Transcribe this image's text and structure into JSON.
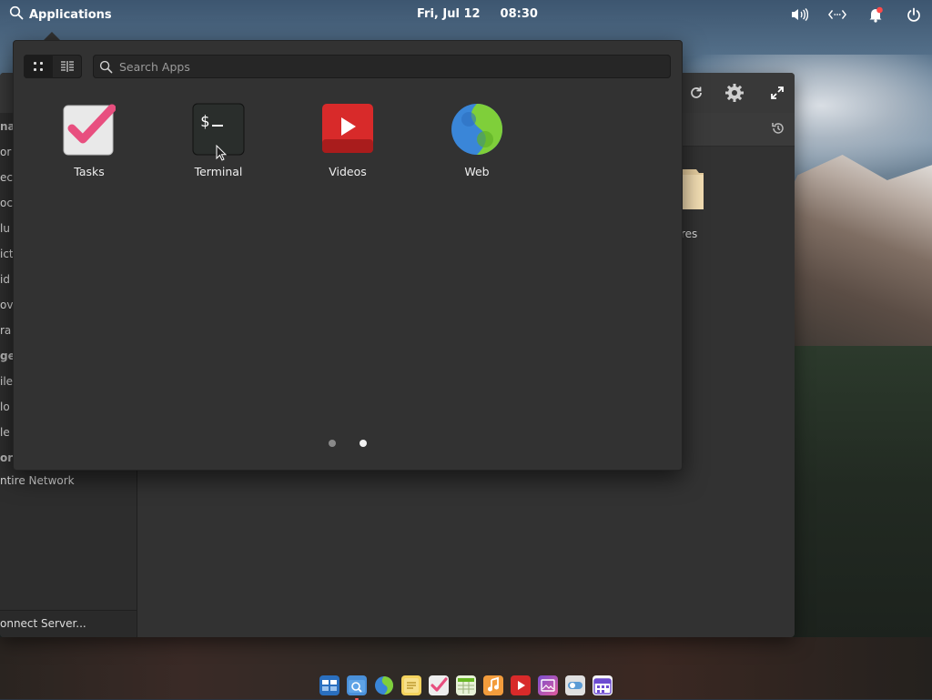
{
  "top_panel": {
    "applications_label": "Applications",
    "date": "Fri, Jul 12",
    "time": "08:30",
    "indicators": [
      "volume-icon",
      "network-icon",
      "notifications-icon",
      "power-icon"
    ]
  },
  "files_window": {
    "sidebar_items": [
      {
        "label": "na",
        "bold": true
      },
      {
        "label": "or",
        "bold": false
      },
      {
        "label": "ec",
        "bold": false
      },
      {
        "label": "oc",
        "bold": false
      },
      {
        "label": "lu",
        "bold": false
      },
      {
        "label": "ict",
        "bold": false
      },
      {
        "label": "id",
        "bold": false
      },
      {
        "label": "ov",
        "bold": false
      },
      {
        "label": "ra",
        "bold": false
      },
      {
        "label": "ge",
        "bold": true
      },
      {
        "label": "ile",
        "bold": false
      },
      {
        "label": "lo",
        "bold": false
      },
      {
        "label": "le",
        "bold": false
      },
      {
        "label": "ork",
        "bold": true
      },
      {
        "label": "ntire Network",
        "bold": false
      }
    ],
    "connect_server": "onnect Server...",
    "folder_label": "res"
  },
  "app_menu": {
    "search_placeholder": "Search Apps",
    "apps": [
      {
        "name": "Tasks"
      },
      {
        "name": "Terminal"
      },
      {
        "name": "Videos"
      },
      {
        "name": "Web"
      }
    ],
    "pages": 2,
    "current_page": 2
  },
  "dock": {
    "items": [
      "multitasking-view",
      "files",
      "web",
      "notes",
      "tasks",
      "spreadsheet",
      "music",
      "videos",
      "photos",
      "settings",
      "calendar"
    ]
  },
  "colors": {
    "accent": "#f2f2f2",
    "notification_badge": "#ff4a4a"
  }
}
